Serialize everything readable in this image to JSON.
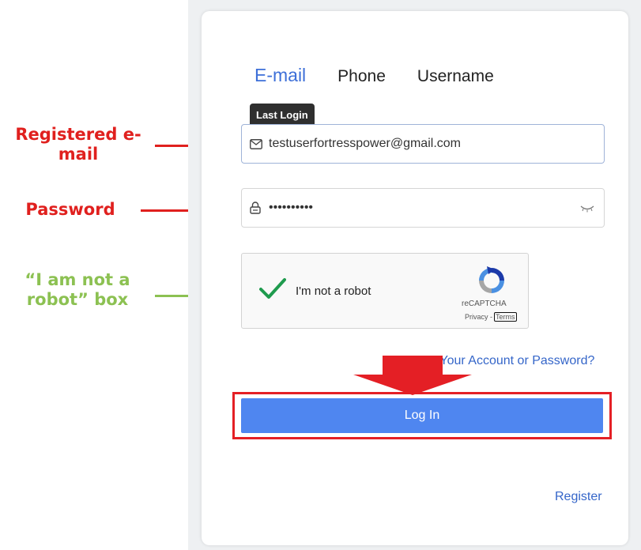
{
  "annotations": {
    "email": "Registered e-mail",
    "password": "Password",
    "robot": "“I am not a robot” box"
  },
  "tabs": [
    {
      "label": "E-mail",
      "active": true
    },
    {
      "label": "Phone",
      "active": false
    },
    {
      "label": "Username",
      "active": false
    }
  ],
  "tooltip": "Last Login",
  "email_field": {
    "value": "testuserfortresspower@gmail.com"
  },
  "password_field": {
    "value": "••••••••••"
  },
  "captcha": {
    "label": "I'm not a robot",
    "brand": "reCAPTCHA",
    "privacy": "Privacy -",
    "terms": "Terms"
  },
  "forgot_link": "Forgot Your Account or Password?",
  "login_button": "Log In",
  "register_link": "Register",
  "colors": {
    "accent": "#4f86f0",
    "link": "#3566c9",
    "annotation_red": "#e0201e",
    "annotation_green": "#8cc152"
  },
  "icons": [
    "mail-icon",
    "lock-icon",
    "eye-closed-icon",
    "checkmark-icon",
    "recaptcha-logo-icon",
    "down-arrow-icon"
  ]
}
